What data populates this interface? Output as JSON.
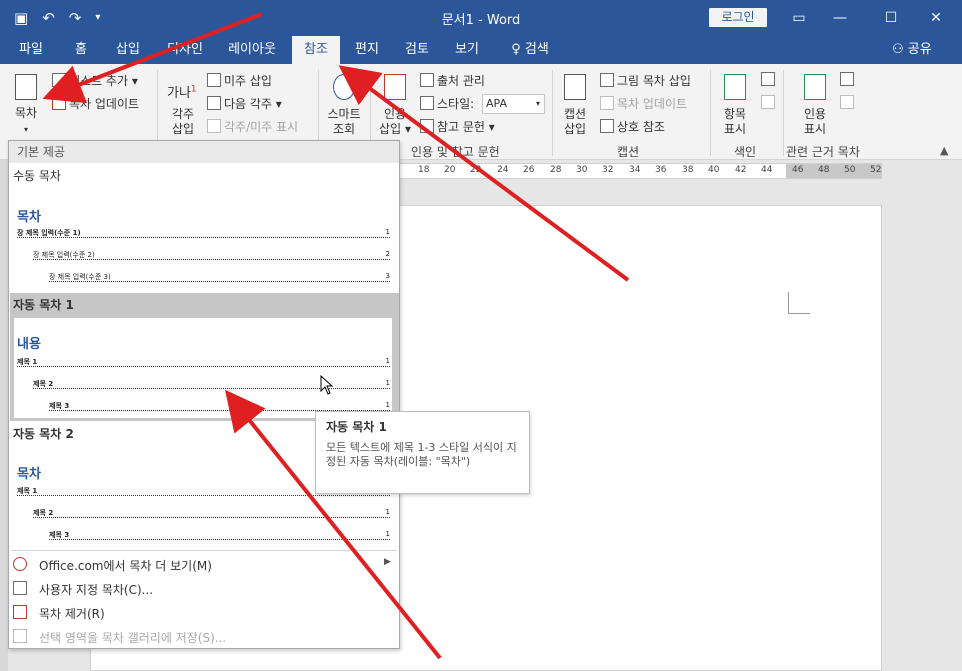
{
  "titlebar": {
    "title": "문서1 - Word",
    "login": "로그인",
    "qat_icons": [
      "save-icon",
      "undo-icon",
      "redo-icon",
      "customize-icon"
    ],
    "window_icons": [
      "ribbon-display-icon",
      "minimize-icon",
      "maximize-icon",
      "close-icon"
    ]
  },
  "tabs": [
    "파일",
    "홈",
    "삽입",
    "디자인",
    "레이아웃",
    "참조",
    "편지",
    "검토",
    "보기",
    "검색"
  ],
  "active_tab": "참조",
  "share": "공유",
  "ribbon": {
    "toc": {
      "label": "목차",
      "add_text": "텍스트 추가",
      "update": "목차 업데이트"
    },
    "footnotes": {
      "insert_footnote_1": "각주",
      "insert_footnote_2": "삽입",
      "insert_endnote": "미주 삽입",
      "next_footnote": "다음 각주",
      "show_notes": "각주/미주 표시",
      "glyph": "가나"
    },
    "research": {
      "smart_1": "스마트",
      "smart_2": "조회"
    },
    "citations": {
      "insert_1": "인용",
      "insert_2": "삽입",
      "manage_sources": "출처 관리",
      "style_label": "스타일:",
      "style_value": "APA",
      "bibliography": "참고 문헌",
      "group_label": "인용 및 참고 문헌"
    },
    "captions": {
      "insert_1": "캡션",
      "insert_2": "삽입",
      "insert_tof": "그림 목차 삽입",
      "update_table": "목차 업데이트",
      "cross_ref": "상호 참조",
      "group_label": "캡션"
    },
    "index": {
      "mark_1": "항목",
      "mark_2": "표시",
      "group_label": "색인"
    },
    "toa": {
      "mark_1": "인용",
      "mark_2": "표시",
      "group_label": "관련 근거 목차"
    }
  },
  "ruler_ticks": [
    "18",
    "20",
    "22",
    "24",
    "26",
    "28",
    "30",
    "32",
    "34",
    "36",
    "38",
    "40",
    "42",
    "44",
    "46",
    "48",
    "50",
    "52"
  ],
  "gallery": {
    "header": "기본 제공",
    "manual": {
      "title": "수동 목차",
      "heading": "목차",
      "lines": [
        {
          "text": "장 제목 입력(수준 1)",
          "num": "1"
        },
        {
          "text": "장 제목 입력(수준 2)",
          "num": "2"
        },
        {
          "text": "장 제목 입력(수준 3)",
          "num": "3"
        }
      ]
    },
    "auto1": {
      "title": "자동 목차 1",
      "heading": "내용",
      "lines": [
        {
          "text": "제목 1",
          "num": "1"
        },
        {
          "text": "제목 2",
          "num": "1"
        },
        {
          "text": "제목 3",
          "num": "1"
        }
      ]
    },
    "auto2": {
      "title": "자동 목차 2",
      "heading": "목차",
      "lines": [
        {
          "text": "제목 1",
          "num": "1"
        },
        {
          "text": "제목 2",
          "num": "1"
        },
        {
          "text": "제목 3",
          "num": "1"
        }
      ]
    }
  },
  "menu": {
    "more": "Office.com에서 목차 더 보기(M)",
    "custom": "사용자 지정 목차(C)...",
    "remove": "목차 제거(R)",
    "save": "선택 영역을 목차 갤러리에 저장(S)..."
  },
  "tooltip": {
    "title": "자동 목차 1",
    "desc": "모든 텍스트에 제목 1-3 스타일 서식이 지정된 자동 목차(레이블: \"목차\")"
  },
  "colors": {
    "accent": "#2b579a",
    "annotation": "#e02020",
    "highlight": "#c6c6c6"
  }
}
